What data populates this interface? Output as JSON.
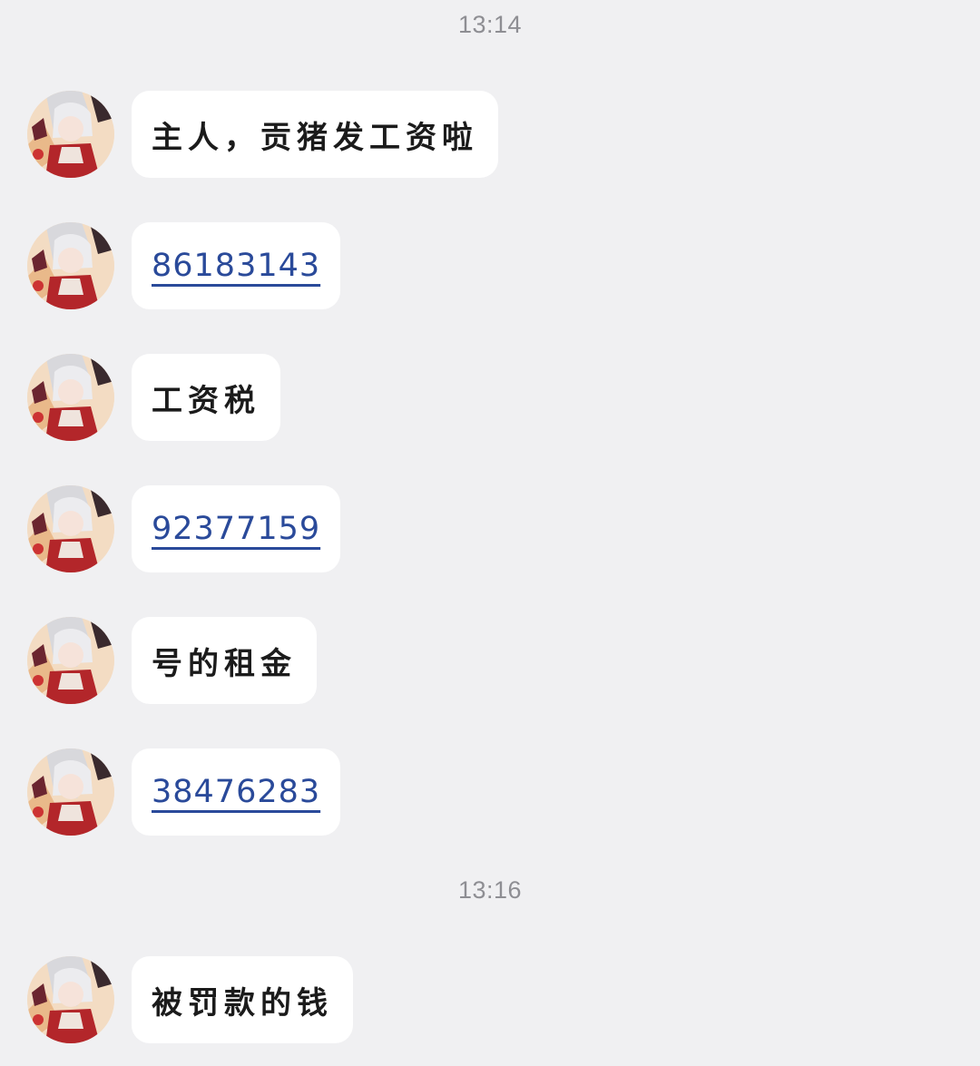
{
  "colors": {
    "background": "#f0f0f2",
    "bubble": "#ffffff",
    "link": "#2a4a9a",
    "timestamp": "#8e8e93",
    "text": "#1b1b1b"
  },
  "timestamps": [
    "13:14",
    "13:16"
  ],
  "messages": [
    {
      "type": "text",
      "text": "主人，贡猪发工资啦",
      "avatar": "anime-character-avatar"
    },
    {
      "type": "link",
      "text": "86183143",
      "avatar": "anime-character-avatar"
    },
    {
      "type": "text",
      "text": "工资税",
      "avatar": "anime-character-avatar"
    },
    {
      "type": "link",
      "text": "92377159",
      "avatar": "anime-character-avatar"
    },
    {
      "type": "text",
      "text": "号的租金",
      "avatar": "anime-character-avatar"
    },
    {
      "type": "link",
      "text": "38476283",
      "avatar": "anime-character-avatar"
    },
    {
      "type": "text",
      "text": "被罚款的钱",
      "avatar": "anime-character-avatar"
    }
  ]
}
